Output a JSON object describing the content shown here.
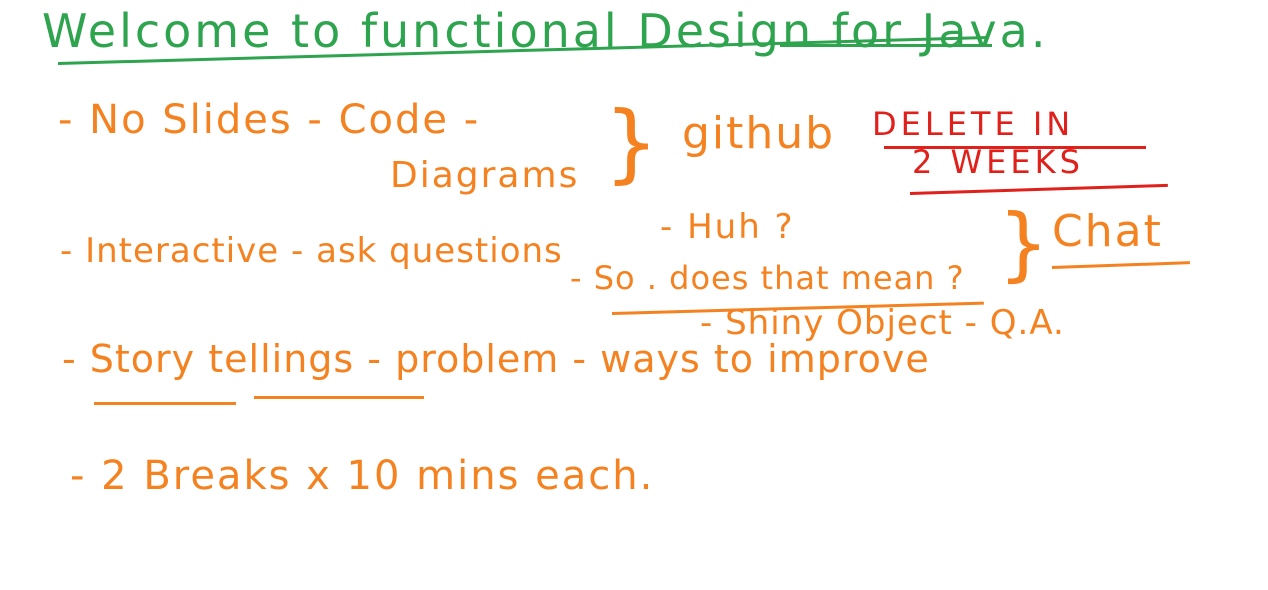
{
  "title": {
    "main": "Welcome to functional Design",
    "suffix": "for Java."
  },
  "bullets": [
    {
      "text": "- No Slides - Code -"
    },
    {
      "text": "- Interactive - ask questions"
    },
    {
      "text": "- Story tellings - problem - ways to improve"
    },
    {
      "text": "- 2 Breaks x 10 mins each."
    }
  ],
  "annotations": {
    "diagrams": "Diagrams",
    "brace_a": "}",
    "github": "github",
    "delete_line1": "DELETE IN",
    "delete_line2": "2 WEEKS",
    "huh": "- Huh ?",
    "so_does": "- So . does that mean ?",
    "brace_b": "}",
    "chat": "Chat",
    "shiny": "- Shiny Object - Q.A."
  },
  "colors": {
    "title": "#2ea44f",
    "body": "#f58220",
    "highlight": "#e0201a",
    "background": "#ffffff"
  }
}
